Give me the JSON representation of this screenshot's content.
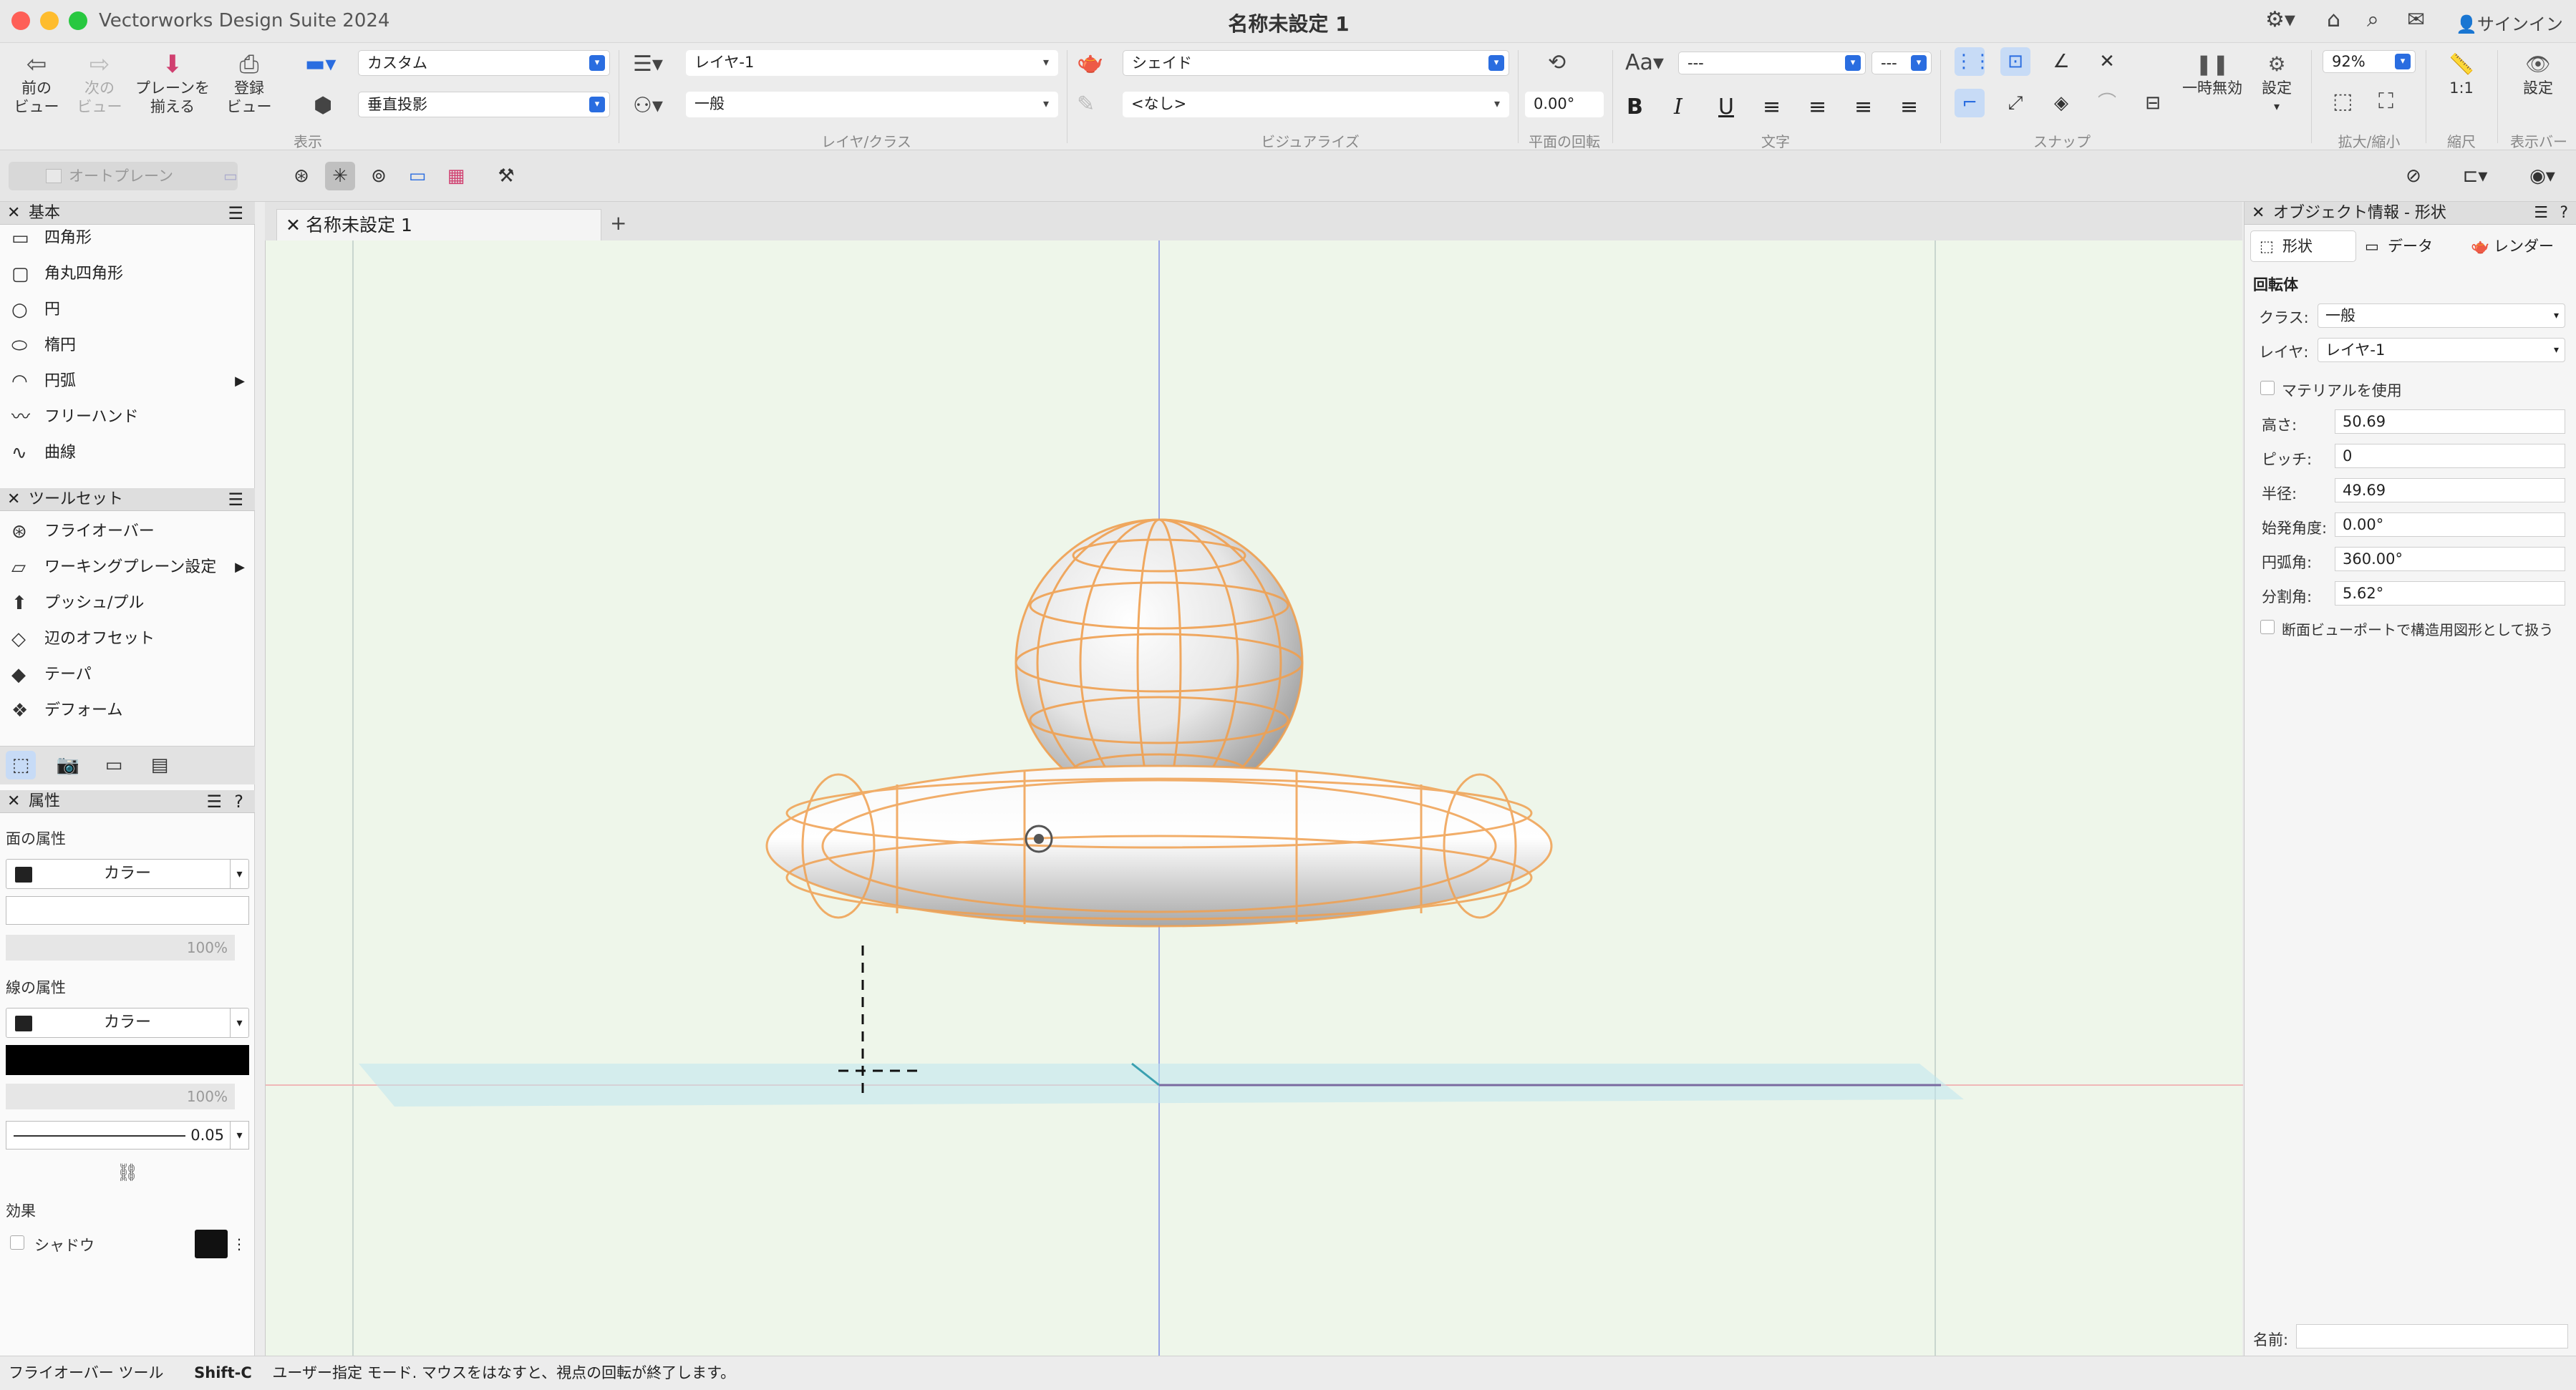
{
  "window": {
    "app_title": "Vectorworks Design Suite 2024",
    "doc_title": "名称未設定 1",
    "signin": "サインイン"
  },
  "ribbon": {
    "prev_view": "前の\nビュー",
    "next_view": "次の\nビュー",
    "align_plane": "プレーンを\n揃える",
    "register_view": "登録\nビュー",
    "view_group": "表示",
    "view_dd1": "カスタム",
    "view_dd2": "垂直投影",
    "layer_dd": "レイヤ-1",
    "class_dd": "一般",
    "layer_class_group": "レイヤ/クラス",
    "render_dd": "シェイド",
    "none_dd": "<なし>",
    "visualize_group": "ビジュアライズ",
    "rotation_value": "0.00°",
    "rotation_group": "平面の回転",
    "font_dd": "---",
    "size_dd": "---",
    "text_group": "文字",
    "snap_group": "スナップ",
    "pause_label": "一時無効",
    "settings_label": "設定",
    "zoom_value": "92%",
    "zoom_group": "拡大/縮小",
    "scale_value": "1:1",
    "scale_group": "縮尺",
    "display_settings": "設定",
    "display_bar_group": "表示バー"
  },
  "row2": {
    "auto_plane": "オートプレーン"
  },
  "basic_panel": {
    "title": "基本",
    "items": [
      {
        "label": "四角形",
        "icon": "rectangle-icon"
      },
      {
        "label": "角丸四角形",
        "icon": "rounded-rectangle-icon"
      },
      {
        "label": "円",
        "icon": "circle-icon"
      },
      {
        "label": "楕円",
        "icon": "ellipse-icon"
      },
      {
        "label": "円弧",
        "icon": "arc-icon"
      },
      {
        "label": "フリーハンド",
        "icon": "freehand-icon"
      },
      {
        "label": "曲線",
        "icon": "curve-icon"
      }
    ]
  },
  "toolset_panel": {
    "title": "ツールセット",
    "items": [
      {
        "label": "フライオーバー",
        "icon": "flyover-icon"
      },
      {
        "label": "ワーキングプレーン設定",
        "icon": "working-plane-icon"
      },
      {
        "label": "プッシュ/プル",
        "icon": "push-pull-icon"
      },
      {
        "label": "辺のオフセット",
        "icon": "offset-edge-icon"
      },
      {
        "label": "テーパ",
        "icon": "taper-icon"
      },
      {
        "label": "デフォーム",
        "icon": "deform-icon"
      }
    ]
  },
  "attr_panel": {
    "title": "属性",
    "fill_label": "面の属性",
    "fill_type": "カラー",
    "fill_opacity": "100%",
    "pen_label": "線の属性",
    "pen_type": "カラー",
    "pen_opacity": "100%",
    "line_weight": "0.05",
    "effects_label": "効果",
    "shadow_label": "シャドウ"
  },
  "canvas": {
    "tab_label": "名称未設定 1"
  },
  "object_info": {
    "title": "オブジェクト情報 - 形状",
    "tabs": [
      "形状",
      "データ",
      "レンダー"
    ],
    "object_type": "回転体",
    "class_label": "クラス:",
    "class_value": "一般",
    "layer_label": "レイヤ:",
    "layer_value": "レイヤ-1",
    "use_material": "マテリアルを使用",
    "height_label": "高さ:",
    "height_value": "50.69",
    "pitch_label": "ピッチ:",
    "pitch_value": "0",
    "radius_label": "半径:",
    "radius_value": "49.69",
    "start_angle_label": "始発角度:",
    "start_angle_value": "0.00°",
    "arc_angle_label": "円弧角:",
    "arc_angle_value": "360.00°",
    "segment_angle_label": "分割角:",
    "segment_angle_value": "5.62°",
    "section_viewport": "断面ビューポートで構造用図形として扱う",
    "name_label": "名前:"
  },
  "statusbar": {
    "tool": "フライオーバー ツール",
    "shortcut": "Shift-C",
    "message": "ユーザー指定 モード. マウスをはなすと、視点の回転が終了します。"
  },
  "colors": {
    "accent": "#2a6de0",
    "wire": "#f0a050",
    "canvas": "#eef6ea"
  }
}
